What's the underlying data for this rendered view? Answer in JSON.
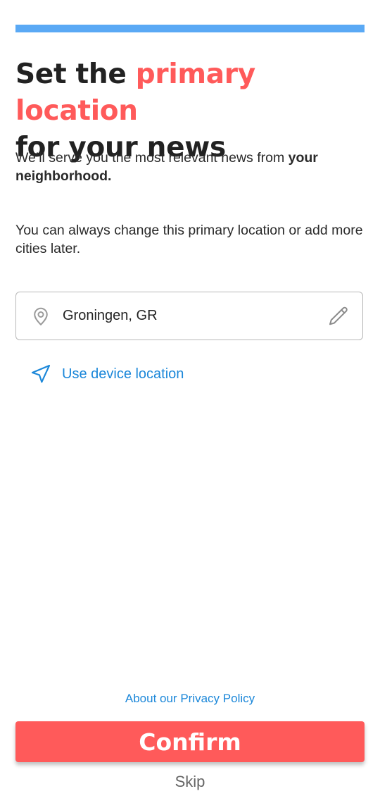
{
  "progress": {
    "value": 1.0,
    "color": "#5aa9f5"
  },
  "header": {
    "title_part1": "Set the ",
    "title_accent": "primary location",
    "title_part2": "for your news",
    "accent_color": "#ff5a5a"
  },
  "intro": {
    "line1_text": "We’ll serve you the most relevant news from ",
    "line1_bold": "your neighborhood.",
    "line2_text": "You can always change this primary location or add more cities later."
  },
  "location_field": {
    "value": "Groningen, GR",
    "leading_icon": "map-pin-icon",
    "trailing_icon": "pencil-icon"
  },
  "device_location": {
    "label": "Use device location",
    "icon": "navigation-arrow-icon",
    "color": "#1b87d9"
  },
  "footer": {
    "privacy_link": "About our Privacy Policy",
    "confirm_label": "Confirm",
    "skip_label": "Skip",
    "confirm_color": "#ff5a5a"
  }
}
